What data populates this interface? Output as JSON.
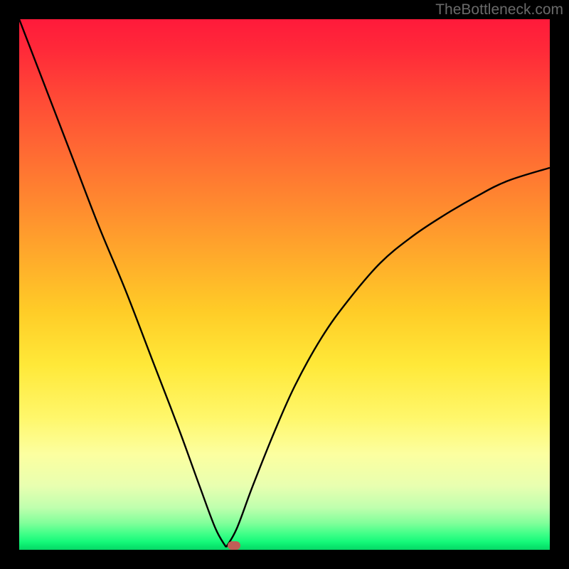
{
  "attribution": "TheBottleneck.com",
  "chart_data": {
    "type": "line",
    "title": "",
    "xlabel": "",
    "ylabel": "",
    "xlim": [
      0,
      100
    ],
    "ylim": [
      0,
      100
    ],
    "grid": false,
    "legend": false,
    "series": [
      {
        "name": "bottleneck-curve",
        "x_min_position": 39,
        "description": "V-shaped bottleneck curve. Left branch descends steeply and nearly linearly from (0,100) to the minimum near x≈39. Right branch rises with decreasing slope (concave) toward roughly (100,72).",
        "left_branch_points": [
          {
            "x": 0,
            "y": 100
          },
          {
            "x": 5,
            "y": 87
          },
          {
            "x": 10,
            "y": 74
          },
          {
            "x": 15,
            "y": 61
          },
          {
            "x": 20,
            "y": 49
          },
          {
            "x": 25,
            "y": 36
          },
          {
            "x": 30,
            "y": 23
          },
          {
            "x": 34,
            "y": 12
          },
          {
            "x": 37,
            "y": 4
          },
          {
            "x": 39,
            "y": 0.5
          }
        ],
        "right_branch_points": [
          {
            "x": 39,
            "y": 0.5
          },
          {
            "x": 41,
            "y": 4
          },
          {
            "x": 44,
            "y": 12
          },
          {
            "x": 48,
            "y": 22
          },
          {
            "x": 52,
            "y": 31
          },
          {
            "x": 57,
            "y": 40
          },
          {
            "x": 62,
            "y": 47
          },
          {
            "x": 68,
            "y": 54
          },
          {
            "x": 74,
            "y": 59
          },
          {
            "x": 80,
            "y": 63
          },
          {
            "x": 86,
            "y": 66.5
          },
          {
            "x": 92,
            "y": 69.5
          },
          {
            "x": 100,
            "y": 72
          }
        ]
      }
    ],
    "marker": {
      "x": 40.5,
      "y": 0.8,
      "color": "#c15f57",
      "shape": "rounded-rect"
    },
    "background_gradient": {
      "type": "vertical",
      "stops": [
        {
          "pos": 0,
          "color": "#ff1a3a"
        },
        {
          "pos": 50,
          "color": "#ffcc27"
        },
        {
          "pos": 85,
          "color": "#fcffa0"
        },
        {
          "pos": 100,
          "color": "#07d766"
        }
      ]
    },
    "frame_color": "#000000"
  }
}
